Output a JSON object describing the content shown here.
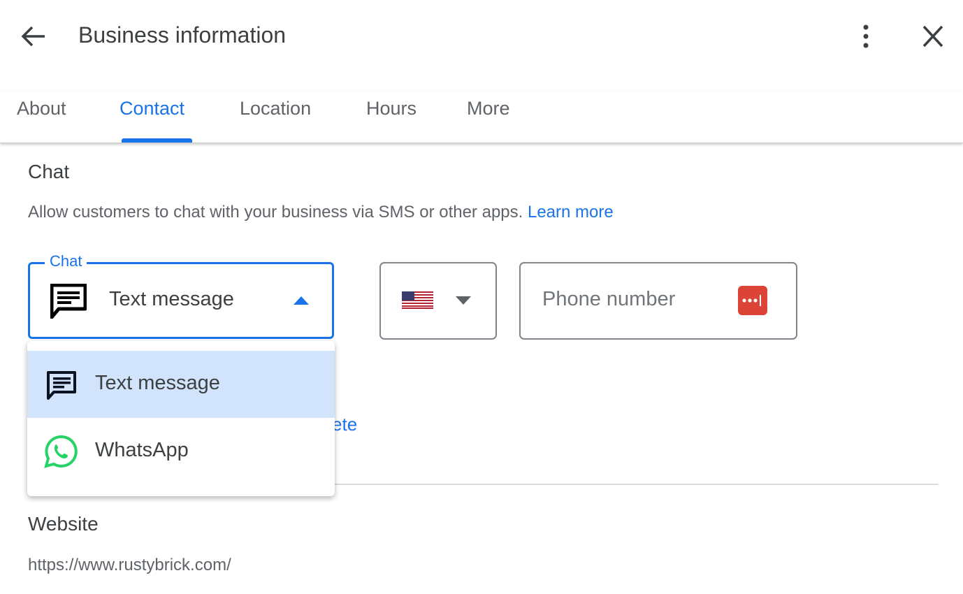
{
  "header": {
    "title": "Business information",
    "back_icon": "arrow-back-icon",
    "menu_icon": "more-vert-icon",
    "close_icon": "close-icon"
  },
  "tabs": [
    {
      "label": "About"
    },
    {
      "label": "Contact",
      "active": true
    },
    {
      "label": "Location"
    },
    {
      "label": "Hours"
    },
    {
      "label": "More"
    }
  ],
  "chat": {
    "heading": "Chat",
    "description": "Allow customers to chat with your business via SMS or other apps.",
    "learn_more": "Learn more",
    "select_label": "Chat",
    "selected": "Text message",
    "country_flag": "US",
    "phone_placeholder": "Phone number",
    "delete_link": "Delete",
    "options": [
      {
        "label": "Text message",
        "icon": "message-icon",
        "highlighted": true
      },
      {
        "label": "WhatsApp",
        "icon": "whatsapp-icon"
      }
    ]
  },
  "website": {
    "heading": "Website",
    "value": "https://www.rustybrick.com/"
  },
  "colors": {
    "accent": "#1a73e8",
    "highlight": "#d2e3fc",
    "whatsapp": "#25d366",
    "password_manager": "#db4437"
  }
}
